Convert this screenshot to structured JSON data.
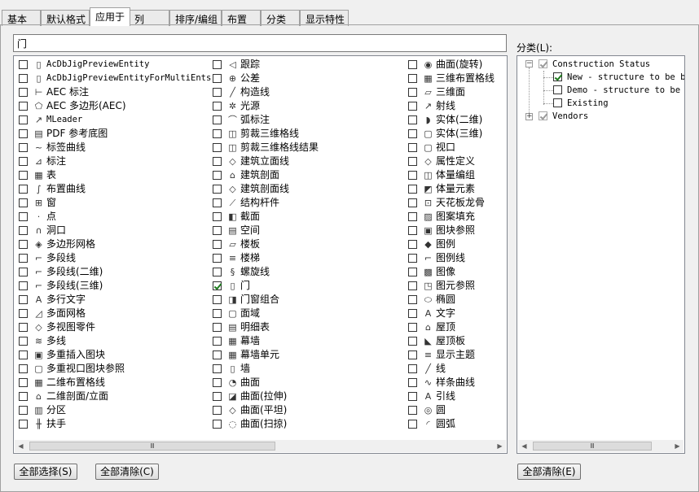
{
  "tabs": [
    {
      "label": "基本"
    },
    {
      "label": "默认格式"
    },
    {
      "label": "应用于"
    },
    {
      "label": "列"
    },
    {
      "label": "排序/编组"
    },
    {
      "label": "布置"
    },
    {
      "label": "分类"
    },
    {
      "label": "显示特性"
    }
  ],
  "search": {
    "value": "门"
  },
  "columns": [
    [
      {
        "label": "AcDbJigPreviewEntity",
        "icon": "document-icon",
        "mono": true,
        "checked": false
      },
      {
        "label": "AcDbJigPreviewEntityForMultiEnts",
        "icon": "document-icon",
        "mono": true,
        "checked": false
      },
      {
        "label": "AEC 标注",
        "icon": "aec-dimension-icon",
        "checked": false
      },
      {
        "label": "AEC 多边形(AEC)",
        "icon": "polygon-icon",
        "checked": false
      },
      {
        "label": "MLeader",
        "icon": "mleader-icon",
        "mono": true,
        "checked": false
      },
      {
        "label": "PDF 参考底图",
        "icon": "pdf-icon",
        "checked": false
      },
      {
        "label": "标签曲线",
        "icon": "label-curve-icon",
        "checked": false
      },
      {
        "label": "标注",
        "icon": "dimension-icon",
        "checked": false
      },
      {
        "label": "表",
        "icon": "table-icon",
        "checked": false
      },
      {
        "label": "布置曲线",
        "icon": "layout-curve-icon",
        "checked": false
      },
      {
        "label": "窗",
        "icon": "window-icon",
        "checked": false
      },
      {
        "label": "点",
        "icon": "point-icon",
        "checked": false
      },
      {
        "label": "洞口",
        "icon": "opening-icon",
        "checked": false
      },
      {
        "label": "多边形网格",
        "icon": "polygon-mesh-icon",
        "checked": false
      },
      {
        "label": "多段线",
        "icon": "polyline-icon",
        "checked": false
      },
      {
        "label": "多段线(二维)",
        "icon": "polyline-2d-icon",
        "checked": false
      },
      {
        "label": "多段线(三维)",
        "icon": "polyline-3d-icon",
        "checked": false
      },
      {
        "label": "多行文字",
        "icon": "mtext-icon",
        "checked": false
      },
      {
        "label": "多面网格",
        "icon": "polyface-mesh-icon",
        "checked": false
      },
      {
        "label": "多视图零件",
        "icon": "multiview-part-icon",
        "checked": false
      },
      {
        "label": "多线",
        "icon": "multiline-icon",
        "checked": false
      },
      {
        "label": "多重插入图块",
        "icon": "minsert-block-icon",
        "checked": false
      },
      {
        "label": "多重视口图块参照",
        "icon": "viewport-block-icon",
        "checked": false
      },
      {
        "label": "二维布置格线",
        "icon": "grid-2d-icon",
        "checked": false
      },
      {
        "label": "二维剖面/立面",
        "icon": "section-2d-icon",
        "checked": false
      },
      {
        "label": "分区",
        "icon": "zone-icon",
        "checked": false
      },
      {
        "label": "扶手",
        "icon": "railing-icon",
        "checked": false
      }
    ],
    [
      {
        "label": "跟踪",
        "icon": "tracking-icon",
        "checked": false
      },
      {
        "label": "公差",
        "icon": "tolerance-icon",
        "checked": false
      },
      {
        "label": "构造线",
        "icon": "xline-icon",
        "checked": false
      },
      {
        "label": "光源",
        "icon": "light-icon",
        "checked": false
      },
      {
        "label": "弧标注",
        "icon": "arc-dimension-icon",
        "checked": false
      },
      {
        "label": "剪裁三维格线",
        "icon": "clipped-grid-icon",
        "checked": false
      },
      {
        "label": "剪裁三维格线结果",
        "icon": "clipped-grid-result-icon",
        "checked": false
      },
      {
        "label": "建筑立面线",
        "icon": "elevation-line-icon",
        "checked": false
      },
      {
        "label": "建筑剖面",
        "icon": "building-section-icon",
        "checked": false
      },
      {
        "label": "建筑剖面线",
        "icon": "section-line-icon",
        "checked": false
      },
      {
        "label": "结构杆件",
        "icon": "structural-member-icon",
        "checked": false
      },
      {
        "label": "截面",
        "icon": "section-icon",
        "checked": false
      },
      {
        "label": "空间",
        "icon": "space-icon",
        "checked": false
      },
      {
        "label": "楼板",
        "icon": "slab-icon",
        "checked": false
      },
      {
        "label": "楼梯",
        "icon": "stair-icon",
        "checked": false
      },
      {
        "label": "螺旋线",
        "icon": "helix-icon",
        "checked": false
      },
      {
        "label": "门",
        "icon": "door-icon",
        "checked": true
      },
      {
        "label": "门窗组合",
        "icon": "door-window-assembly-icon",
        "checked": false
      },
      {
        "label": "面域",
        "icon": "region-icon",
        "checked": false
      },
      {
        "label": "明细表",
        "icon": "schedule-icon",
        "checked": false
      },
      {
        "label": "幕墙",
        "icon": "curtain-wall-icon",
        "checked": false
      },
      {
        "label": "幕墙单元",
        "icon": "curtain-wall-unit-icon",
        "checked": false
      },
      {
        "label": "墙",
        "icon": "wall-icon",
        "checked": false
      },
      {
        "label": "曲面",
        "icon": "surface-icon",
        "checked": false
      },
      {
        "label": "曲面(拉伸)",
        "icon": "surface-extrude-icon",
        "checked": false
      },
      {
        "label": "曲面(平坦)",
        "icon": "surface-planar-icon",
        "checked": false
      },
      {
        "label": "曲面(扫掠)",
        "icon": "surface-sweep-icon",
        "checked": false
      }
    ],
    [
      {
        "label": "曲面(旋转)",
        "icon": "surface-revolve-icon",
        "checked": false
      },
      {
        "label": "三维布置格线",
        "icon": "grid-3d-icon",
        "checked": false
      },
      {
        "label": "三维面",
        "icon": "face-3d-icon",
        "checked": false
      },
      {
        "label": "射线",
        "icon": "ray-icon",
        "checked": false
      },
      {
        "label": "实体(二维)",
        "icon": "solid-2d-icon",
        "checked": false
      },
      {
        "label": "实体(三维)",
        "icon": "solid-3d-icon",
        "checked": false
      },
      {
        "label": "视口",
        "icon": "viewport-icon",
        "checked": false
      },
      {
        "label": "属性定义",
        "icon": "attribute-definition-icon",
        "checked": false
      },
      {
        "label": "体量编组",
        "icon": "mass-group-icon",
        "checked": false
      },
      {
        "label": "体量元素",
        "icon": "mass-element-icon",
        "checked": false
      },
      {
        "label": "天花板龙骨",
        "icon": "ceiling-grid-icon",
        "checked": false
      },
      {
        "label": "图案填充",
        "icon": "hatch-icon",
        "checked": false
      },
      {
        "label": "图块参照",
        "icon": "block-reference-icon",
        "checked": false
      },
      {
        "label": "图例",
        "icon": "legend-icon",
        "checked": false
      },
      {
        "label": "图例线",
        "icon": "legend-line-icon",
        "checked": false
      },
      {
        "label": "图像",
        "icon": "image-icon",
        "checked": false
      },
      {
        "label": "图元参照",
        "icon": "entity-reference-icon",
        "checked": false
      },
      {
        "label": "椭圆",
        "icon": "ellipse-icon",
        "checked": false
      },
      {
        "label": "文字",
        "icon": "text-icon",
        "checked": false
      },
      {
        "label": "屋顶",
        "icon": "roof-icon",
        "checked": false
      },
      {
        "label": "屋顶板",
        "icon": "roof-slab-icon",
        "checked": false
      },
      {
        "label": "显示主题",
        "icon": "display-theme-icon",
        "checked": false
      },
      {
        "label": "线",
        "icon": "line-icon",
        "checked": false
      },
      {
        "label": "样条曲线",
        "icon": "spline-icon",
        "checked": false
      },
      {
        "label": "引线",
        "icon": "leader-icon",
        "checked": false
      },
      {
        "label": "圆",
        "icon": "circle-icon",
        "checked": false
      },
      {
        "label": "圆弧",
        "icon": "arc-icon",
        "checked": false
      }
    ]
  ],
  "scrollbar": {
    "thumb": "Ⅲ"
  },
  "category": {
    "label": "分类(L):",
    "tree": [
      {
        "label": "Construction Status",
        "checked": true,
        "expanded": true,
        "children": [
          {
            "label": "New - structure to be bu",
            "checked": true
          },
          {
            "label": "Demo - structure to be d",
            "checked": false
          },
          {
            "label": "Existing",
            "checked": false
          }
        ]
      },
      {
        "label": "Vendors",
        "checked": true,
        "expanded": false,
        "children": []
      }
    ]
  },
  "buttons": {
    "select_all": "全部选择(S)",
    "clear_all": "全部清除(C)",
    "clear_all_category": "全部清除(E)"
  }
}
